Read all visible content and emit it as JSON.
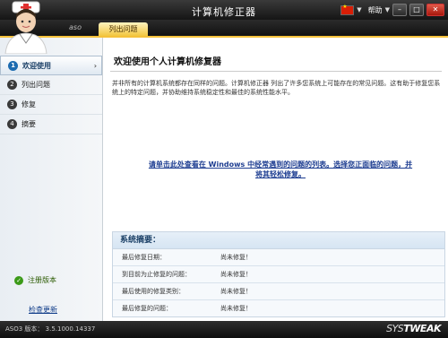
{
  "window": {
    "title": "计算机修正器",
    "help_label": "帮助",
    "help_arrow": "▼",
    "win_min": "–",
    "win_max": "□",
    "win_close": "✕"
  },
  "tabs": {
    "brand": "aso",
    "active": "列出问题"
  },
  "sidebar": {
    "items": [
      {
        "num": "1",
        "label": "欢迎使用",
        "chevron": "›"
      },
      {
        "num": "2",
        "label": "列出问题"
      },
      {
        "num": "3",
        "label": "修复"
      },
      {
        "num": "4",
        "label": "摘要"
      }
    ],
    "registered": "注册版本",
    "check_update": "检查更新"
  },
  "main": {
    "title": "欢迎使用个人计算机修复器",
    "description": "并非所有的计算机系统都存在同样的问题。计算机修正器 列出了许多您系统上可能存在的常见问题。这有助于修复您系统上的特定问题，并协助维持系统稳定性和最佳的系统性能水平。",
    "problems_link": "请单击此处查看在 Windows 中经常遇到的问题的列表。选择您正面临的问题，并将其轻松修复。"
  },
  "summary": {
    "title": "系统摘要：",
    "rows": [
      {
        "label": "最后修复日期：",
        "value": "尚未修复！"
      },
      {
        "label": "到目前为止修复的问题：",
        "value": "尚未修复！"
      },
      {
        "label": "最后使用的修复类别：",
        "value": "尚未修复！"
      },
      {
        "label": "最后修复的问题：",
        "value": "尚未修复！"
      }
    ]
  },
  "status": {
    "version": "ASO3 版本： 3.5.1000.14337",
    "logo_sys": "SYS",
    "logo_tweak": "TWEAK"
  },
  "colors": {
    "accent_yellow": "#f4c13b",
    "link_blue": "#1d3d91",
    "active_nav": "#1c6bb0"
  }
}
